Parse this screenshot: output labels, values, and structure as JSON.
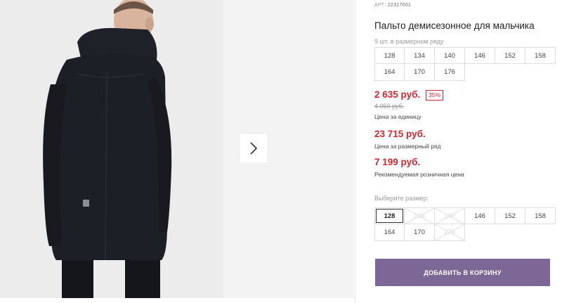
{
  "product": {
    "article_label": "АРТ:",
    "article": "22317001",
    "title": "Пальто демисезонное для мальчика",
    "pack_caption": "9 шт. в размерном ряду",
    "pack_sizes": [
      "128",
      "134",
      "140",
      "146",
      "152",
      "158",
      "164",
      "170",
      "176"
    ],
    "price_unit": "2 635 руб.",
    "discount": "35%",
    "price_old": "4 050 руб.",
    "price_unit_label": "Цена за единицу",
    "price_range": "23 715 руб.",
    "price_range_label": "Цена за размерный ряд",
    "price_rrp": "7 199 руб.",
    "price_rrp_label": "Рекомендуемая розничная цена",
    "choose_caption": "Выберите размер:",
    "choose_sizes": [
      {
        "label": "128",
        "state": "selected"
      },
      {
        "label": "134",
        "state": "disabled"
      },
      {
        "label": "140",
        "state": "disabled"
      },
      {
        "label": "146",
        "state": "available"
      },
      {
        "label": "152",
        "state": "available"
      },
      {
        "label": "158",
        "state": "available"
      },
      {
        "label": "164",
        "state": "available"
      },
      {
        "label": "170",
        "state": "available"
      },
      {
        "label": "176",
        "state": "disabled"
      }
    ],
    "add_to_cart": "ДОБАВИТЬ В КОРЗИНУ"
  },
  "gallery": {
    "next_icon": "chevron-right-icon"
  },
  "colors": {
    "price": "#d4252f",
    "button": "#7d6796",
    "coat": "#1d1f26"
  }
}
